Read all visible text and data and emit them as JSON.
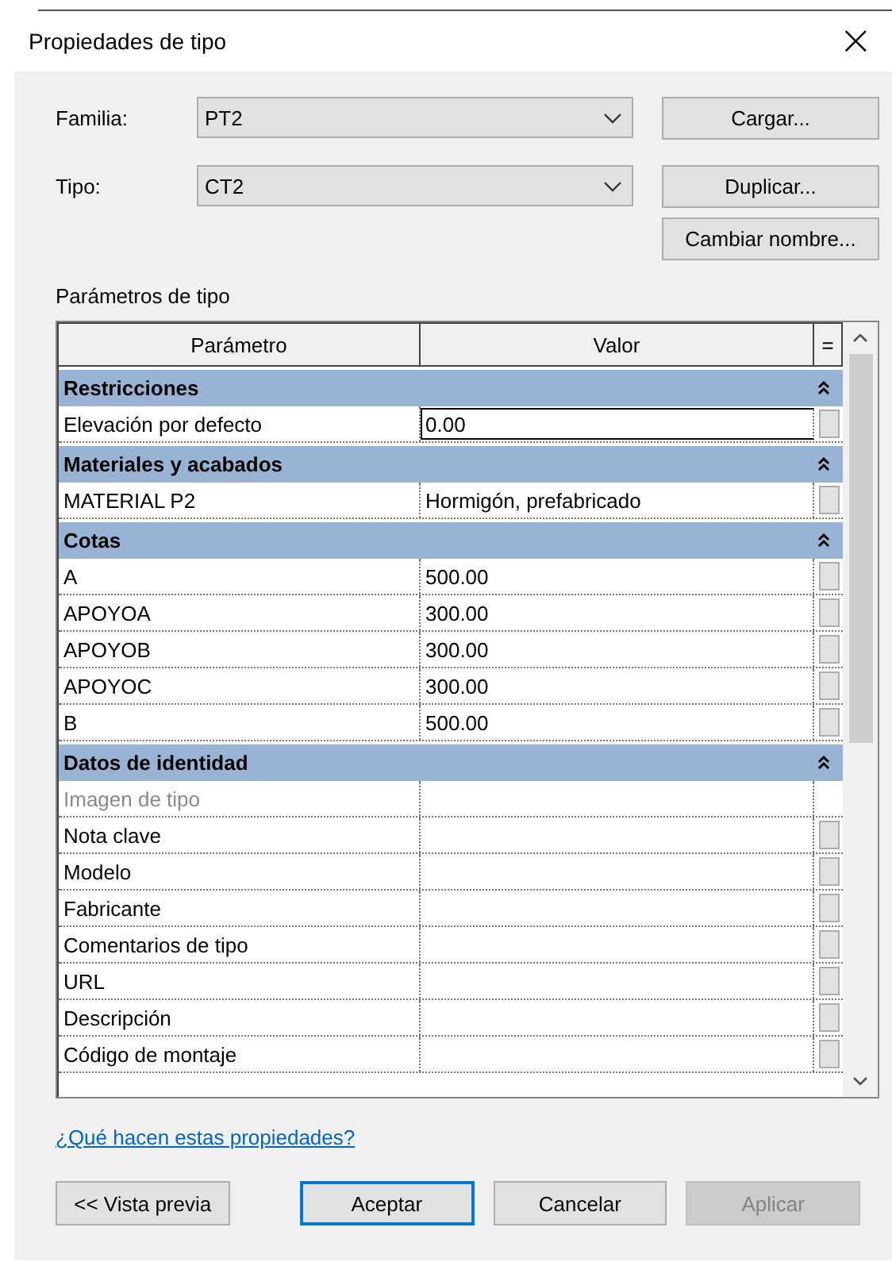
{
  "window": {
    "title": "Propiedades de tipo",
    "close": "×"
  },
  "fields": [
    {
      "label": "Familia:",
      "value": "PT2",
      "button": "Cargar..."
    },
    {
      "label": "Tipo:",
      "value": "CT2",
      "button": "Duplicar..."
    }
  ],
  "rename_button": "Cambiar nombre...",
  "section_label": "Parámetros de tipo",
  "table": {
    "columns": [
      "Parámetro",
      "Valor",
      "="
    ],
    "groups": [
      {
        "name": "Restricciones",
        "expanded": true,
        "rows": [
          {
            "name": "Elevación por defecto",
            "value": "0.00",
            "editing": true,
            "disabled": false
          }
        ]
      },
      {
        "name": "Materiales y acabados",
        "expanded": true,
        "rows": [
          {
            "name": "MATERIAL P2",
            "value": "Hormigón, prefabricado",
            "editing": false,
            "disabled": false
          }
        ]
      },
      {
        "name": "Cotas",
        "expanded": true,
        "rows": [
          {
            "name": "A",
            "value": "500.00",
            "editing": false,
            "disabled": false
          },
          {
            "name": "APOYOA",
            "value": "300.00",
            "editing": false,
            "disabled": false
          },
          {
            "name": "APOYOB",
            "value": "300.00",
            "editing": false,
            "disabled": false
          },
          {
            "name": "APOYOC",
            "value": "300.00",
            "editing": false,
            "disabled": false
          },
          {
            "name": "B",
            "value": "500.00",
            "editing": false,
            "disabled": false
          }
        ]
      },
      {
        "name": "Datos de identidad",
        "expanded": true,
        "rows": [
          {
            "name": "Imagen de tipo",
            "editing": false,
            "disabled": true
          },
          {
            "name": "Nota clave",
            "editing": false,
            "disabled": false
          },
          {
            "name": "Modelo",
            "editing": false,
            "disabled": false
          },
          {
            "name": "Fabricante",
            "editing": false,
            "disabled": false
          },
          {
            "name": "Comentarios de tipo",
            "editing": false,
            "disabled": false
          },
          {
            "name": "URL",
            "editing": false,
            "disabled": false
          },
          {
            "name": "Descripción",
            "editing": false,
            "disabled": false
          },
          {
            "name": "Código de montaje",
            "editing": false,
            "disabled": false
          }
        ]
      }
    ]
  },
  "help_link": "¿Qué hacen estas propiedades?",
  "buttons": [
    {
      "label": "<< Vista previa",
      "kind": "normal",
      "disabled": false
    },
    {
      "label": "Aceptar",
      "kind": "default",
      "disabled": false
    },
    {
      "label": "Cancelar",
      "kind": "normal",
      "disabled": false
    },
    {
      "label": "Aplicar",
      "kind": "normal",
      "disabled": true
    }
  ]
}
